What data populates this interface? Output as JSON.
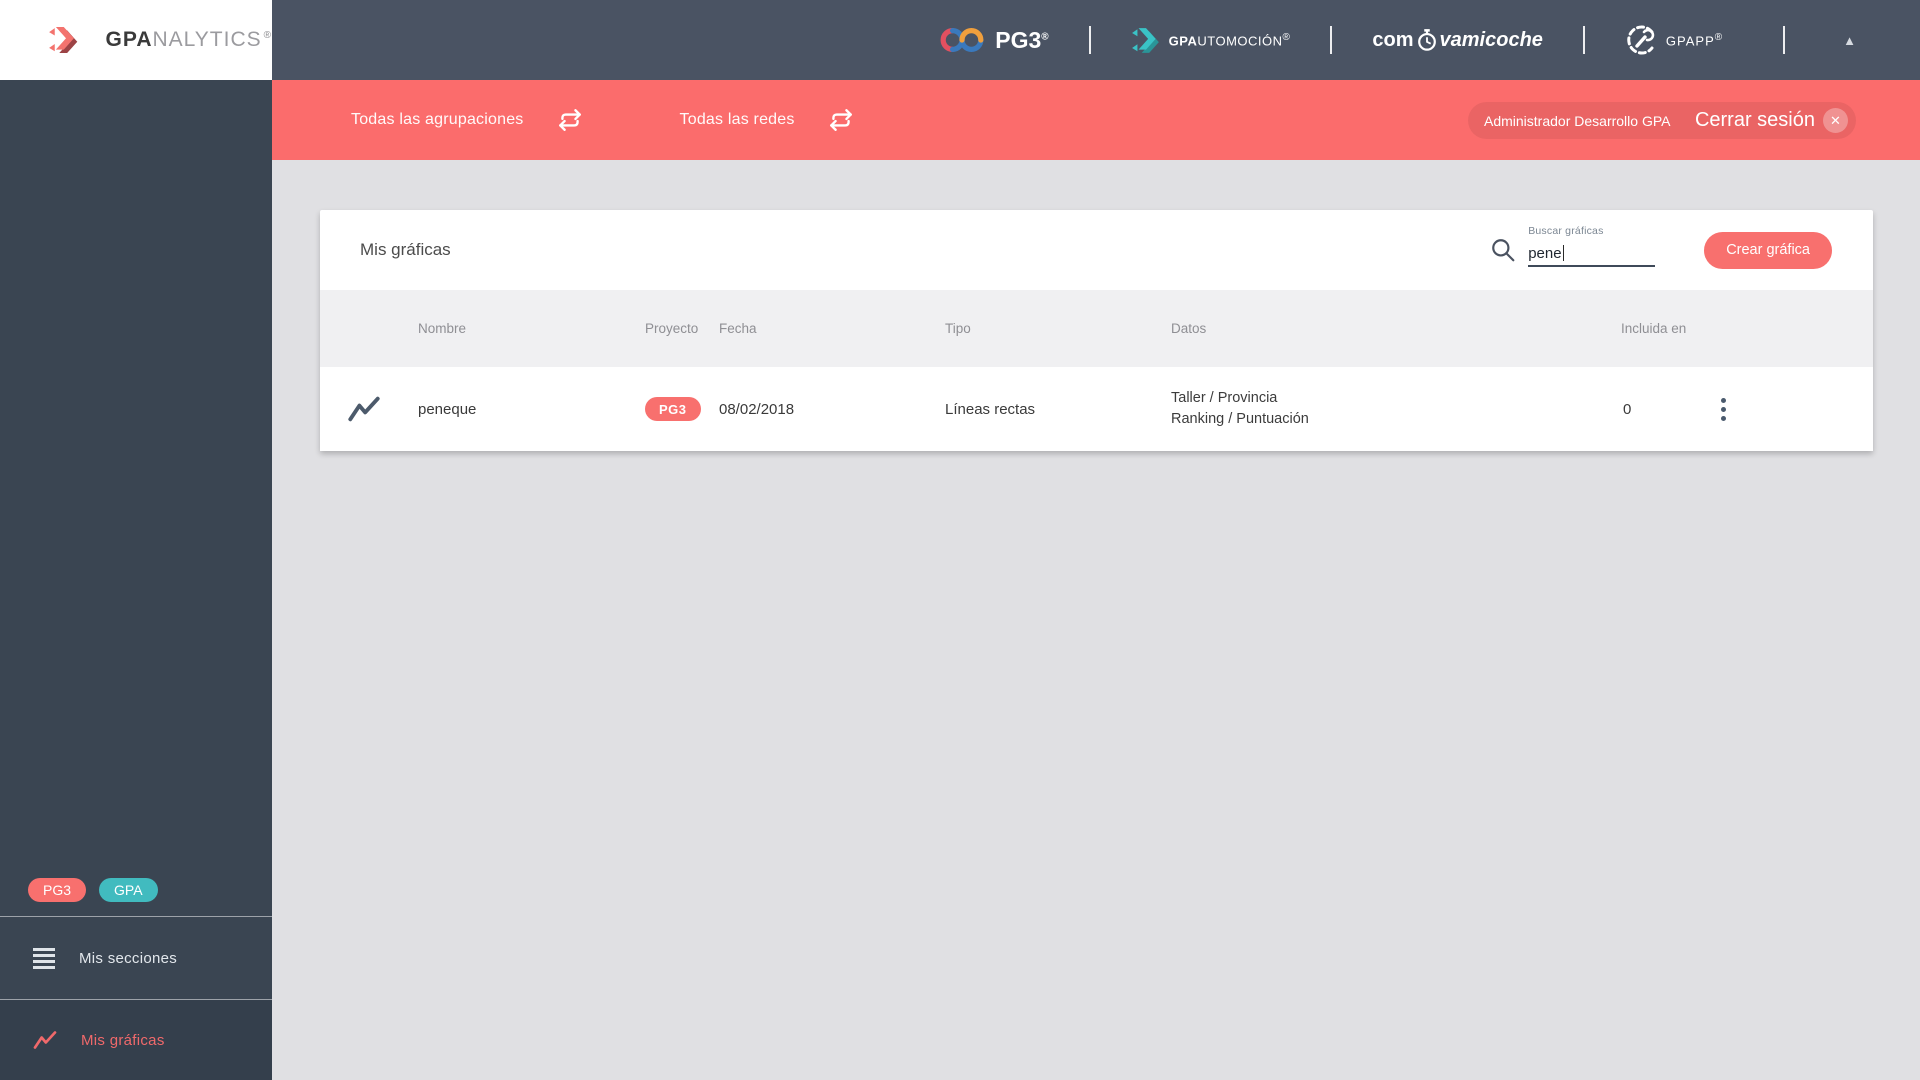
{
  "branding": {
    "logo_gpa": "GPA",
    "logo_nalytics": "NALYTICS",
    "reg": "®"
  },
  "topbar": {
    "pg3_label": "PG3",
    "pg3_reg": "®",
    "gpautomocion_bold": "GPA",
    "gpautomocion_rest": "UTOMOCIÓN",
    "gpautomocion_reg": "®",
    "comeva_com": "com",
    "comeva_coche": "vamicoche",
    "gpapp_label": "GPAPP",
    "gpapp_reg": "®",
    "collapse_icon": "▲"
  },
  "filterbar": {
    "agrupaciones_label": "Todas las agrupaciones",
    "redes_label": "Todas las redes",
    "user_name": "Administrador Desarrollo GPA",
    "logout_label": "Cerrar sesión",
    "logout_close_icon": "✕"
  },
  "sidebar": {
    "badges": [
      {
        "label": "PG3",
        "color": "#f8706e"
      },
      {
        "label": "GPA",
        "color": "#41bbbf"
      }
    ],
    "sections_label": "Mis secciones",
    "graphs_label": "Mis gráficas"
  },
  "card": {
    "title": "Mis gráficas",
    "search": {
      "label": "Buscar gráficas",
      "value": "pene"
    },
    "create_button": "Crear gráfica",
    "table": {
      "headers": [
        "Nombre",
        "Proyecto",
        "Fecha",
        "Tipo",
        "Datos",
        "Incluida en"
      ],
      "rows": [
        {
          "nombre": "peneque",
          "proyecto_badge": "PG3",
          "fecha": "08/02/2018",
          "tipo": "Líneas rectas",
          "datos_line1": "Taller / Provincia",
          "datos_line2": "Ranking / Puntuación",
          "incluida_en": "0"
        }
      ]
    }
  },
  "colors": {
    "accent_red": "#fb6c6c",
    "badge_teal": "#41bbbf",
    "topbar_dark": "#4a5363",
    "sidebar_dark": "#3a4552"
  }
}
